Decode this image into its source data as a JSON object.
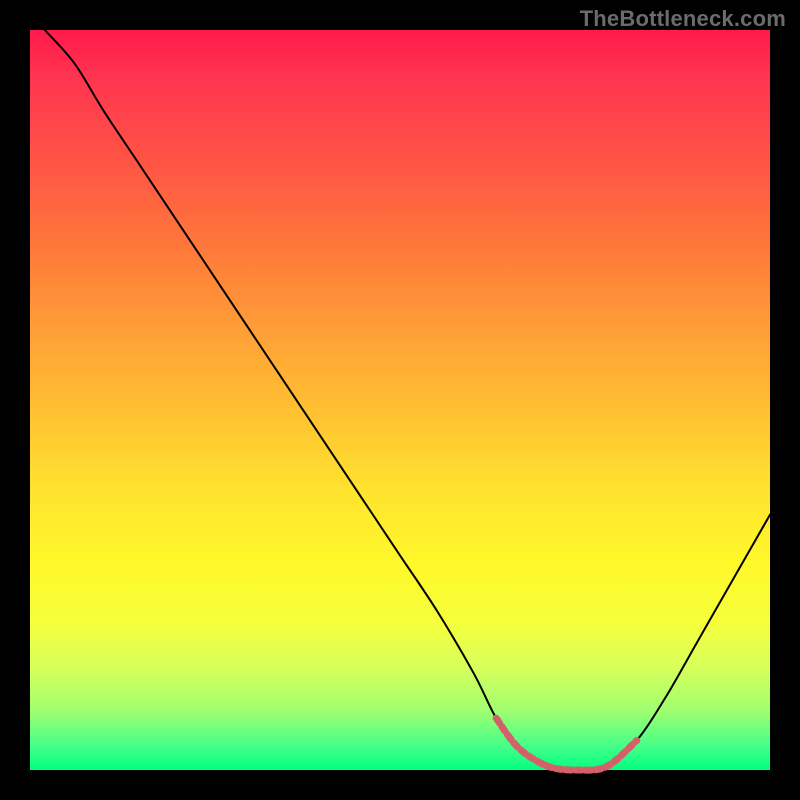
{
  "watermark": "TheBottleneck.com",
  "chart_data": {
    "type": "line",
    "title": "",
    "xlabel": "",
    "ylabel": "",
    "xlim": [
      0,
      100
    ],
    "ylim": [
      0,
      100
    ],
    "grid": false,
    "background_gradient": {
      "top": "#ff1a4a",
      "mid1": "#ff9a36",
      "mid2": "#fff82a",
      "bottom": "#00ff80"
    },
    "series": [
      {
        "name": "bottleneck-curve",
        "color": "#000000",
        "stroke_width": 2,
        "x": [
          2,
          6,
          10,
          15,
          20,
          25,
          30,
          35,
          40,
          45,
          50,
          55,
          60,
          63,
          66,
          70,
          74,
          78,
          82,
          86,
          90,
          94,
          98,
          100
        ],
        "values": [
          100,
          95.5,
          89,
          81.5,
          74,
          66.5,
          59,
          51.5,
          44,
          36.5,
          29,
          21.5,
          13,
          7,
          3,
          0.5,
          0,
          0.5,
          4,
          10,
          17,
          24,
          31,
          34.5
        ]
      },
      {
        "name": "optimal-range",
        "color": "#d4606a",
        "stroke_width": 6,
        "x": [
          63,
          66,
          70,
          74,
          78,
          82
        ],
        "values": [
          7,
          3,
          0.5,
          0,
          0.5,
          4
        ]
      }
    ],
    "optimal_range_x": [
      66,
      80
    ]
  }
}
